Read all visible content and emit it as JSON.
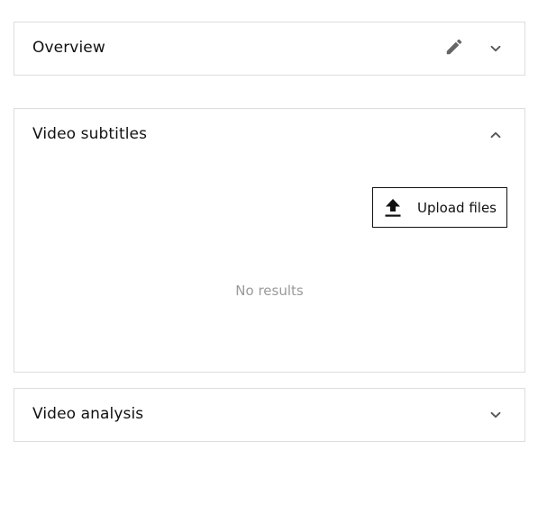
{
  "overview": {
    "title": "Overview",
    "edit_icon": "pencil-icon",
    "toggle_icon": "chevron-down-icon"
  },
  "subtitles": {
    "title": "Video subtitles",
    "toggle_icon": "chevron-up-icon",
    "upload_label": "Upload files",
    "upload_icon": "upload-icon",
    "empty_text": "No results"
  },
  "analysis": {
    "title": "Video analysis",
    "toggle_icon": "chevron-down-icon"
  },
  "colors": {
    "border": "#dddddd",
    "text": "#111111",
    "muted": "#9a9a9a",
    "icon": "#666666"
  }
}
